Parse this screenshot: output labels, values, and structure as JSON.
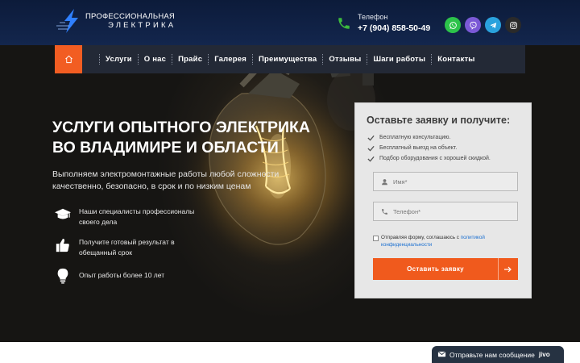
{
  "logo": {
    "line1": "ПРОФЕССИОНАЛЬНАЯ",
    "line2": "ЭЛЕКТРИКА"
  },
  "contact": {
    "label": "Телефон",
    "number": "+7 (904) 858-50-49"
  },
  "socials": [
    {
      "icon": "whatsapp-icon",
      "color": "#2cc34a"
    },
    {
      "icon": "viber-icon",
      "color": "#7b59d6"
    },
    {
      "icon": "telegram-icon",
      "color": "#2aa2dd"
    },
    {
      "icon": "instagram-icon",
      "color": "#2a2a2a"
    }
  ],
  "nav": {
    "home_icon": "home-icon",
    "items": [
      "Услуги",
      "О нас",
      "Прайс",
      "Галерея",
      "Преимущества",
      "Отзывы",
      "Шаги работы",
      "Контакты"
    ]
  },
  "hero": {
    "title_line1": "УСЛУГИ ОПЫТНОГО ЭЛЕКТРИКА",
    "title_line2": "ВО ВЛАДИМИРЕ И ОБЛАСТИ",
    "subtitle": "Выполняем электромонтажные работы любой сложности качественно, безопасно, в срок и по низким ценам",
    "features": [
      {
        "icon": "graduation-cap-icon",
        "line1": "Наши специалисты профессионалы",
        "line2": "своего дела"
      },
      {
        "icon": "thumbs-up-icon",
        "line1": "Получите готовый результат в",
        "line2": "обещанный срок"
      },
      {
        "icon": "lightbulb-icon",
        "line1": "Опыт работы более 10 лет",
        "line2": ""
      }
    ]
  },
  "form": {
    "title": "Оставьте заявку и получите:",
    "bullets": [
      "Бесплатную консультацию.",
      "Бесплатный выезд на объект.",
      "Подбор оборудования с хорошей скидкой."
    ],
    "name_placeholder": "Имя*",
    "phone_placeholder": "Телефон*",
    "consent_text": "Отправляя форму, соглашаюсь с ",
    "consent_link": "политикой конфиденциальности",
    "submit_label": "Оставить заявку"
  },
  "chat": {
    "text": "Отправьте нам сообщение",
    "brand": "jivo"
  },
  "colors": {
    "accent": "#f05a1d",
    "header": "#13264d",
    "nav": "#232936"
  }
}
